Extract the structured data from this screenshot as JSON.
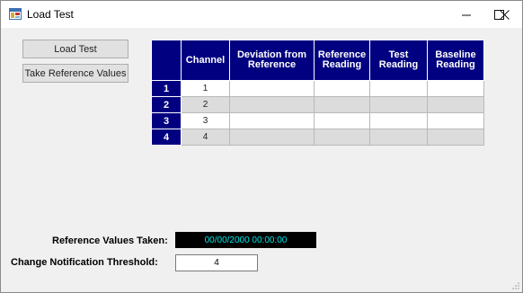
{
  "window": {
    "title": "Load Test",
    "controls": {
      "minimize": "—",
      "maximize": "☐",
      "close": "✕"
    }
  },
  "buttons": {
    "load_test": "Load Test",
    "take_reference": "Take Reference Values"
  },
  "table": {
    "headers": [
      "Channel",
      "Deviation from Reference",
      "Reference Reading",
      "Test Reading",
      "Baseline Reading"
    ],
    "rows": [
      {
        "row_header": "1",
        "channel": "1",
        "deviation": "",
        "reference": "",
        "test": "",
        "baseline": ""
      },
      {
        "row_header": "2",
        "channel": "2",
        "deviation": "",
        "reference": "",
        "test": "",
        "baseline": ""
      },
      {
        "row_header": "3",
        "channel": "3",
        "deviation": "",
        "reference": "",
        "test": "",
        "baseline": ""
      },
      {
        "row_header": "4",
        "channel": "4",
        "deviation": "",
        "reference": "",
        "test": "",
        "baseline": ""
      }
    ]
  },
  "reference_taken": {
    "label": "Reference Values Taken:",
    "value": "00/00/2000 00:00:00"
  },
  "threshold": {
    "label": "Change Notification Threshold:",
    "value": "4"
  },
  "colors": {
    "header_bg": "#000080",
    "timestamp_text": "#00e5e5",
    "timestamp_bg": "#000000"
  }
}
